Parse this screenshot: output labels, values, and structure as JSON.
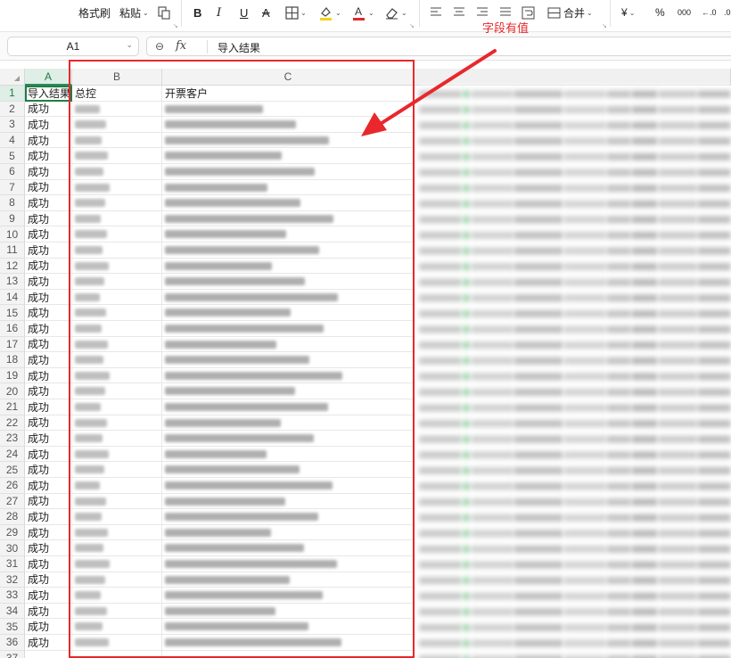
{
  "toolbar": {
    "format_painter": "格式刷",
    "paste": "粘贴",
    "bold": "B",
    "italic": "I",
    "underline": "U",
    "strikethrough": "A",
    "merge": "合并",
    "currency": "¥",
    "percent": "%",
    "thousands": "000",
    "decimal_increase": "←.0",
    "fill_color": "#f5d21c",
    "font_color": "#e0282c"
  },
  "formula_bar": {
    "cell_ref": "A1",
    "fx": "fx",
    "content": "导入结果"
  },
  "columns": [
    "A",
    "B",
    "C"
  ],
  "header_row": {
    "a": "导入结果",
    "b": "总控",
    "c": "开票客户"
  },
  "row_numbers": [
    "1",
    "2",
    "3",
    "4",
    "5",
    "6",
    "7",
    "8",
    "9",
    "10",
    "11",
    "12",
    "13",
    "14",
    "15",
    "16",
    "17",
    "18",
    "19",
    "20",
    "21",
    "22",
    "23",
    "24",
    "25",
    "26",
    "27",
    "28",
    "29",
    "30",
    "31",
    "32",
    "33",
    "34",
    "35",
    "36",
    "37"
  ],
  "result_values": [
    "成功",
    "成功",
    "成功",
    "成功",
    "成功",
    "成功",
    "成功",
    "成功",
    "成功",
    "成功",
    "成功",
    "成功",
    "成功",
    "成功",
    "成功",
    "成功",
    "成功",
    "成功",
    "成功",
    "成功",
    "成功",
    "成功",
    "成功",
    "成功",
    "成功",
    "成功",
    "成功",
    "成功",
    "成功",
    "成功",
    "成功",
    "成功",
    "成功",
    "成功",
    "成功"
  ],
  "annotation": {
    "text": "字段有值",
    "color": "#e8282c"
  }
}
